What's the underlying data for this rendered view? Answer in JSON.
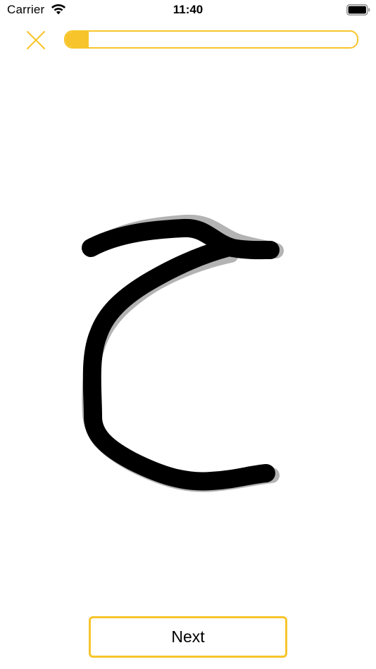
{
  "status_bar": {
    "carrier": "Carrier",
    "time": "11:40",
    "wifi_icon": "wifi-icon",
    "battery_icon": "battery-icon"
  },
  "top_bar": {
    "close_icon": "close-icon",
    "progress_fraction": 0.08
  },
  "drawing": {
    "stroke_color": "#000000",
    "shadow_color": "#b3b3b3"
  },
  "next_button": {
    "label": "Next"
  },
  "colors": {
    "accent": "#f7c52b",
    "background": "#ffffff"
  }
}
